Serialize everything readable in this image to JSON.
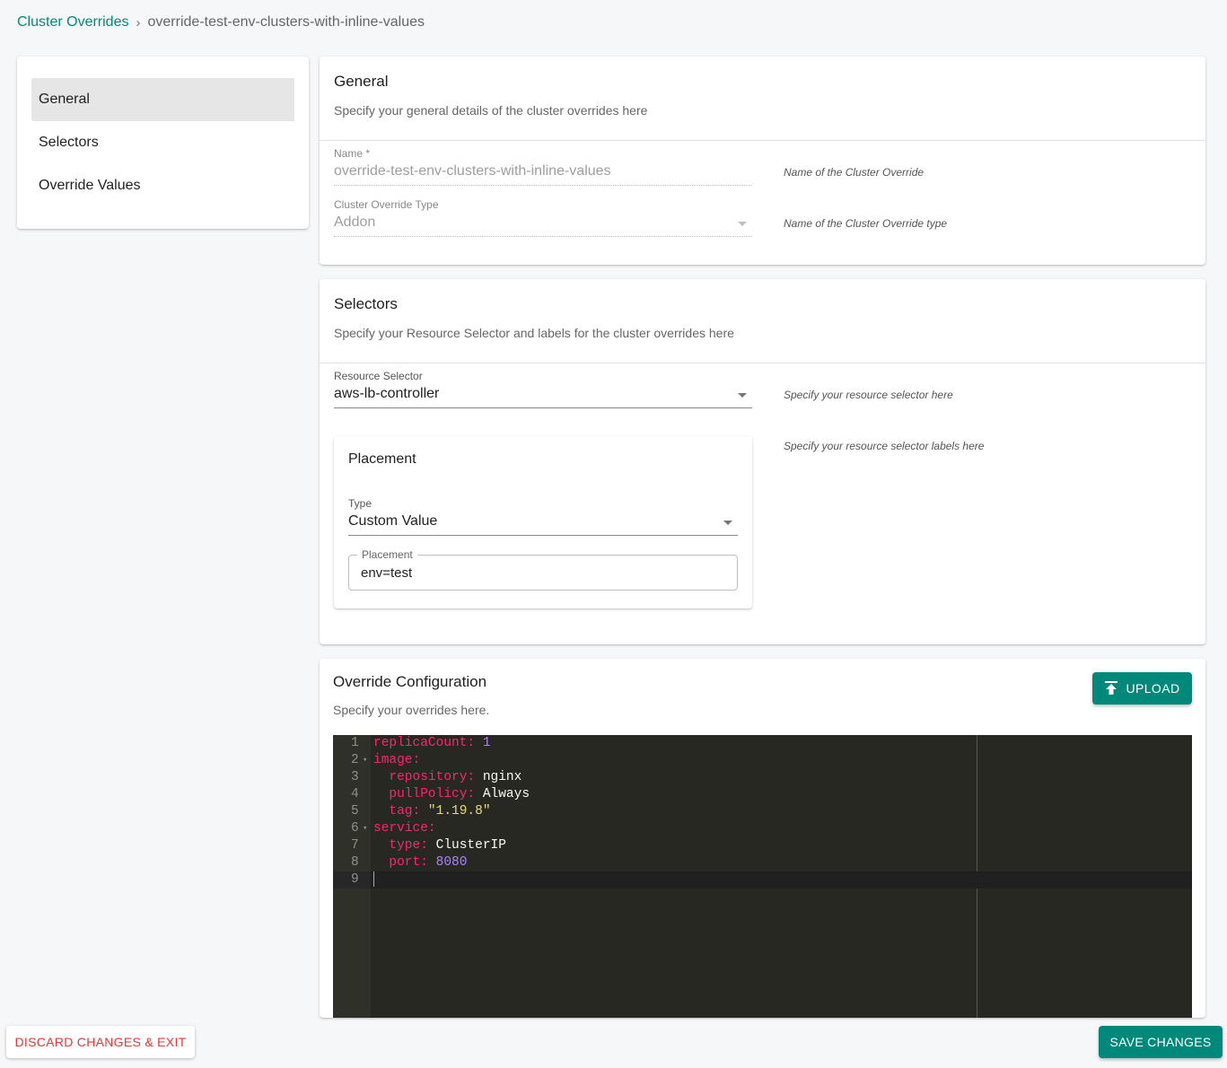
{
  "breadcrumb": {
    "parent": "Cluster Overrides",
    "separator": "›",
    "current": "override-test-env-clusters-with-inline-values"
  },
  "nav": {
    "items": [
      {
        "label": "General",
        "active": true
      },
      {
        "label": "Selectors",
        "active": false
      },
      {
        "label": "Override Values",
        "active": false
      }
    ]
  },
  "general": {
    "title": "General",
    "description": "Specify your general details of the cluster overrides here",
    "name_label": "Name *",
    "name_value": "override-test-env-clusters-with-inline-values",
    "name_hint": "Name of the Cluster Override",
    "type_label": "Cluster Override Type",
    "type_value": "Addon",
    "type_hint": "Name of the Cluster Override type"
  },
  "selectors": {
    "title": "Selectors",
    "description": "Specify your Resource Selector and labels for the cluster overrides here",
    "resource_label": "Resource Selector",
    "resource_value": "aws-lb-controller",
    "resource_hint": "Specify your resource selector here",
    "labels_hint": "Specify your resource selector labels here",
    "placement": {
      "title": "Placement",
      "type_label": "Type",
      "type_value": "Custom Value",
      "field_label": "Placement",
      "field_value": "env=test"
    }
  },
  "override": {
    "title": "Override Configuration",
    "description": "Specify your overrides here.",
    "upload_label": "UPLOAD",
    "editor": {
      "lines": [
        {
          "num": "1",
          "key": "replicaCount:",
          "indent": "",
          "value": " 1",
          "vtype": "n",
          "fold": false
        },
        {
          "num": "2",
          "key": "image:",
          "indent": "",
          "value": "",
          "vtype": "",
          "fold": true
        },
        {
          "num": "3",
          "key": "repository:",
          "indent": "  ",
          "value": " nginx",
          "vtype": "",
          "fold": false
        },
        {
          "num": "4",
          "key": "pullPolicy:",
          "indent": "  ",
          "value": " Always",
          "vtype": "",
          "fold": false
        },
        {
          "num": "5",
          "key": "tag:",
          "indent": "  ",
          "value": " \"1.19.8\"",
          "vtype": "s",
          "fold": false
        },
        {
          "num": "6",
          "key": "service:",
          "indent": "",
          "value": "",
          "vtype": "",
          "fold": true
        },
        {
          "num": "7",
          "key": "type:",
          "indent": "  ",
          "value": " ClusterIP",
          "vtype": "",
          "fold": false
        },
        {
          "num": "8",
          "key": "port:",
          "indent": "  ",
          "value": " 8080",
          "vtype": "n",
          "fold": false
        },
        {
          "num": "9",
          "key": "",
          "indent": "",
          "value": "",
          "vtype": "",
          "fold": false
        }
      ]
    }
  },
  "footer": {
    "discard_label": "DISCARD CHANGES & EXIT",
    "save_label": "SAVE CHANGES"
  },
  "colors": {
    "accent": "#00897b",
    "danger": "#e53935",
    "editor_bg": "#272822"
  }
}
